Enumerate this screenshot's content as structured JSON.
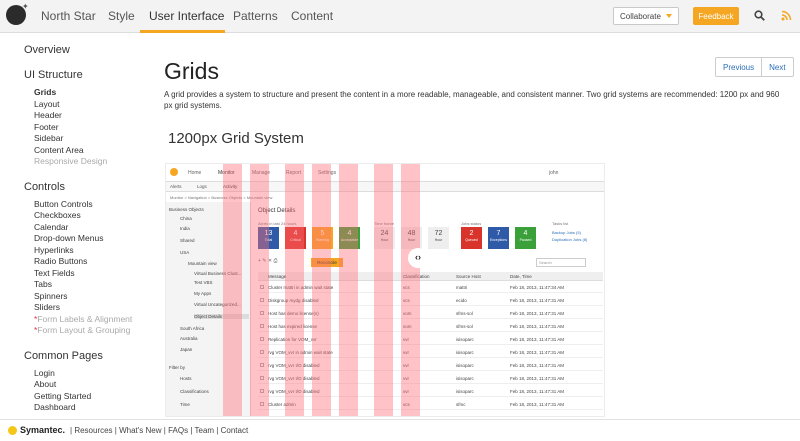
{
  "nav": {
    "items": [
      "North Star",
      "Style",
      "User Interface",
      "Patterns",
      "Content"
    ],
    "active": "User Interface",
    "collaborate_label": "Collaborate",
    "feedback_label": "Feedback"
  },
  "sidebar": {
    "sections": [
      {
        "title": "Overview",
        "items": []
      },
      {
        "title": "UI Structure",
        "items": [
          {
            "label": "Grids",
            "state": "active"
          },
          {
            "label": "Layout"
          },
          {
            "label": "Header"
          },
          {
            "label": "Footer"
          },
          {
            "label": "Sidebar"
          },
          {
            "label": "Content Area"
          },
          {
            "label": "Responsive Design",
            "state": "muted"
          }
        ]
      },
      {
        "title": "Controls",
        "items": [
          {
            "label": "Button Controls"
          },
          {
            "label": "Checkboxes"
          },
          {
            "label": "Calendar"
          },
          {
            "label": "Drop-down Menus"
          },
          {
            "label": "Hyperlinks"
          },
          {
            "label": "Radio Buttons"
          },
          {
            "label": "Text Fields"
          },
          {
            "label": "Tabs"
          },
          {
            "label": "Spinners"
          },
          {
            "label": "Sliders"
          },
          {
            "label": "Form Labels & Alignment",
            "state": "starred"
          },
          {
            "label": "Form Layout & Grouping",
            "state": "starred"
          }
        ]
      },
      {
        "title": "Common Pages",
        "items": [
          {
            "label": "Login"
          },
          {
            "label": "About"
          },
          {
            "label": "Getting Started"
          },
          {
            "label": "Dashboard"
          }
        ]
      }
    ]
  },
  "main": {
    "title": "Grids",
    "description": "A grid provides a system to structure and present the content in a more readable, manageable, and consistent manner. Two grid systems are recommended: 1200 px and 960 px grid systems.",
    "subheading": "1200px Grid System",
    "previous_label": "Previous",
    "next_label": "Next"
  },
  "screenshot": {
    "top_tabs": [
      "Home",
      "Monitor",
      "Manage",
      "Report",
      "Settings"
    ],
    "user": "john",
    "sub_tabs": [
      "Alerts",
      "Logs",
      "Activity"
    ],
    "breadcrumb": "Monitor > Navigation > Business Objects > Mountain view",
    "tree": [
      "Business Objects",
      "China",
      "India",
      "Shared",
      "USA",
      "Mountain view",
      "Virtual Business Clust...",
      "Test VBS",
      "My Apps",
      "Virtual Uncategorized...",
      "Object Details",
      "South Africa",
      "Australia",
      "Japan"
    ],
    "filter_title": "Filter by",
    "filters": [
      "Hosts",
      "Classifications",
      "Time"
    ],
    "panel_title": "Object Details",
    "alerts_label": "Alerts in last 24 hours",
    "alert_tiles": [
      {
        "value": "13",
        "label": "Total",
        "color": "#2f5aa8"
      },
      {
        "value": "4",
        "label": "Critical",
        "color": "#d9342b"
      },
      {
        "value": "5",
        "label": "Warning",
        "color": "#f5a623"
      },
      {
        "value": "4",
        "label": "Acceptable",
        "color": "#3aa03a"
      }
    ],
    "timeframe_label": "Time frame",
    "time_tiles": [
      {
        "value": "24",
        "label": "Hour"
      },
      {
        "value": "48",
        "label": "Hour"
      },
      {
        "value": "72",
        "label": "Hour"
      }
    ],
    "jobs_label": "Jobs status",
    "job_tiles": [
      {
        "value": "2",
        "label": "Queued",
        "color": "#d9342b"
      },
      {
        "value": "7",
        "label": "Exceptions",
        "color": "#2f5aa8"
      },
      {
        "value": "4",
        "label": "Paused",
        "color": "#3aa03a"
      }
    ],
    "tasks_label": "Tasks list",
    "task_links": [
      "Backup Jobs (5)",
      "Duplication Jobs (8)"
    ],
    "reconcile_label": "Reconcile",
    "search_placeholder": "Search",
    "columns": [
      "Message",
      "Classification",
      "Source Host",
      "Date, Time"
    ],
    "rows": [
      [
        "Cluster mattri in admin wait state",
        "vcs",
        "mattri",
        "Feb 18, 2013, 11:47:34 AM"
      ],
      [
        "Diskgroup mydg disabled",
        "vcs",
        "ecido",
        "Feb 18, 2013, 11:47:31 AM"
      ],
      [
        "Host has demo license(s)",
        "vom",
        "sfms-sol",
        "Feb 18, 2013, 11:47:31 AM"
      ],
      [
        "Host has expired license",
        "vom",
        "sfms-sol",
        "Feb 18, 2013, 11:47:31 AM"
      ],
      [
        "Replication for VOM_vvr",
        "vvr",
        "isisoparc",
        "Feb 18, 2013, 11:47:31 AM"
      ],
      [
        "rvg VOM_vvr in admin wait state",
        "vvr",
        "isisoparc",
        "Feb 18, 2013, 11:47:31 AM"
      ],
      [
        "rvg VOM_vvr I/O disabled",
        "vvr",
        "isisoparc",
        "Feb 18, 2013, 11:47:31 AM"
      ],
      [
        "rvg VOM_vvr I/O disabled",
        "vvr",
        "isisoparc",
        "Feb 18, 2013, 11:47:31 AM"
      ],
      [
        "rvg VOM_vvr I/O disabled",
        "vvr",
        "isisoparc",
        "Feb 18, 2013, 11:47:31 AM"
      ],
      [
        "Cluster admin",
        "vcs",
        "sfmc",
        "Feb 18, 2013, 11:47:31 AM"
      ]
    ]
  },
  "footer": {
    "brand": "Symantec.",
    "links": [
      "Resources",
      "What's New",
      "FAQs",
      "Team",
      "Contact"
    ]
  },
  "colors": {
    "accent": "#f5a623",
    "link": "#2a6ebb",
    "grid_overlay": "#ff6e78"
  }
}
